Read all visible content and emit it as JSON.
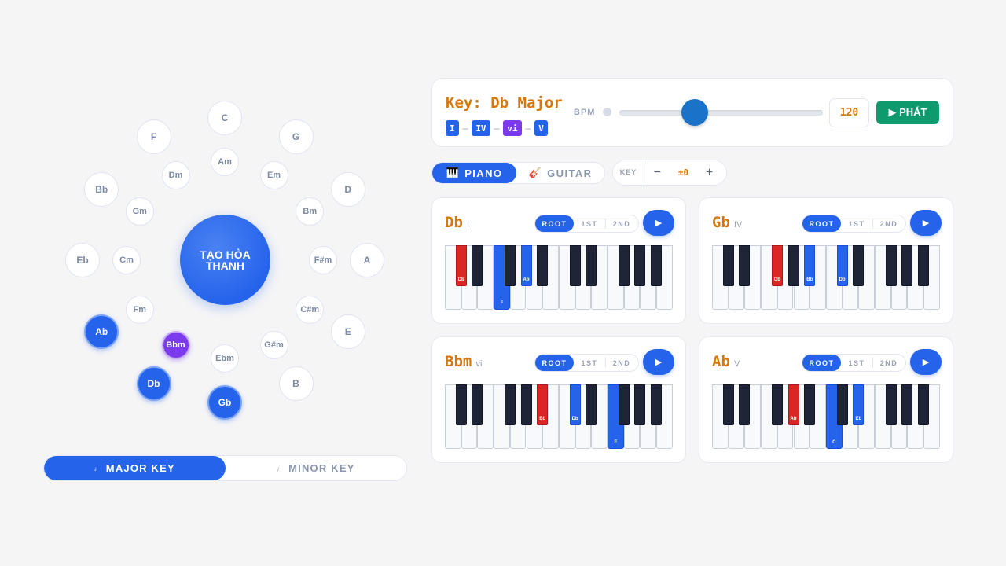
{
  "wheel": {
    "center_label": "TẠO HÒA THANH",
    "major": [
      "C",
      "G",
      "D",
      "A",
      "E",
      "B",
      "Gb",
      "Db",
      "Ab",
      "Eb",
      "Bb",
      "F"
    ],
    "minor": [
      "Am",
      "Em",
      "Bm",
      "F#m",
      "C#m",
      "G#m",
      "Ebm",
      "Bbm",
      "Fm",
      "Cm",
      "Gm",
      "Dm"
    ],
    "selected_major": [
      "Gb",
      "Db",
      "Ab"
    ],
    "selected_minor": [
      "Bbm"
    ]
  },
  "mode_toggle": {
    "major_label": "MAJOR KEY",
    "minor_label": "MINOR KEY",
    "active": "major",
    "note_icon": "music-note-icon"
  },
  "header": {
    "key_title": "Key: Db Major",
    "progression": [
      "I",
      "IV",
      "vi",
      "V"
    ],
    "bpm_label": "BPM",
    "bpm_value": "120",
    "play_label": "▶ PHÁT"
  },
  "instrument": {
    "piano_label": "PIANO",
    "guitar_label": "GUITAR",
    "active": "piano"
  },
  "transpose": {
    "label": "KEY",
    "minus": "−",
    "value": "±0",
    "plus": "+"
  },
  "inversion_labels": [
    "ROOT",
    "1ST",
    "2ND"
  ],
  "cards": [
    {
      "name": "Db",
      "degree": "I",
      "inversion": "ROOT",
      "notes": [
        "Db",
        "F",
        "Ab"
      ]
    },
    {
      "name": "Gb",
      "degree": "IV",
      "inversion": "ROOT",
      "notes": [
        "Gb",
        "Bb",
        "Db"
      ]
    },
    {
      "name": "Bbm",
      "degree": "vi",
      "inversion": "ROOT",
      "notes": [
        "Bb",
        "Db",
        "F"
      ]
    },
    {
      "name": "Ab",
      "degree": "V",
      "inversion": "ROOT",
      "notes": [
        "Ab",
        "C",
        "Eb"
      ]
    }
  ],
  "colors": {
    "accent": "#2563eb",
    "root": "#dc2626",
    "key_text": "#d97706",
    "play_green": "#0f9a6e",
    "minor_selected": "#7c3aed"
  }
}
